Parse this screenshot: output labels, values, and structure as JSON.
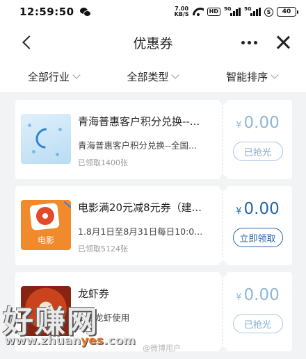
{
  "status_bar": {
    "time": "12:59:50",
    "net_speed_value": "7.00",
    "net_speed_unit": "KB/S",
    "hd": "HD",
    "signal_1": "5G",
    "signal_2": "5G",
    "battery": "40"
  },
  "nav": {
    "title": "优惠券"
  },
  "filters": [
    {
      "label": "全部行业"
    },
    {
      "label": "全部类型"
    },
    {
      "label": "智能排序"
    }
  ],
  "coupons": [
    {
      "title": "青海普惠客户积分兑换--...",
      "description": "青海普惠客户积分兑换--全国...",
      "claimed": "已领取1400张",
      "currency": "¥",
      "price": "0.00",
      "button": "已抢光",
      "status": "sold-out"
    },
    {
      "title": "电影满20元减8元券（建...",
      "description": "1.8月1日至8月31日每日10:0...",
      "claimed": "已领取5124张",
      "currency": "¥",
      "price": "0.00",
      "button": "立即领取",
      "status": "available",
      "thumb_caption": "电影"
    },
    {
      "title": "龙虾券",
      "description": "...店龙虾使用",
      "claimed": "",
      "currency": "¥",
      "price": "0.00",
      "button": "已抢光",
      "status": "sold-out"
    }
  ],
  "watermark": {
    "text": "好赚网",
    "url_prefix": "www.zhuan",
    "url_highlight": "yes",
    "url_suffix": ".com",
    "weibo": "@微博用户"
  },
  "colors": {
    "accent": "#2566a8",
    "muted_accent": "#8fb6d8",
    "background": "#f2f3f5"
  }
}
